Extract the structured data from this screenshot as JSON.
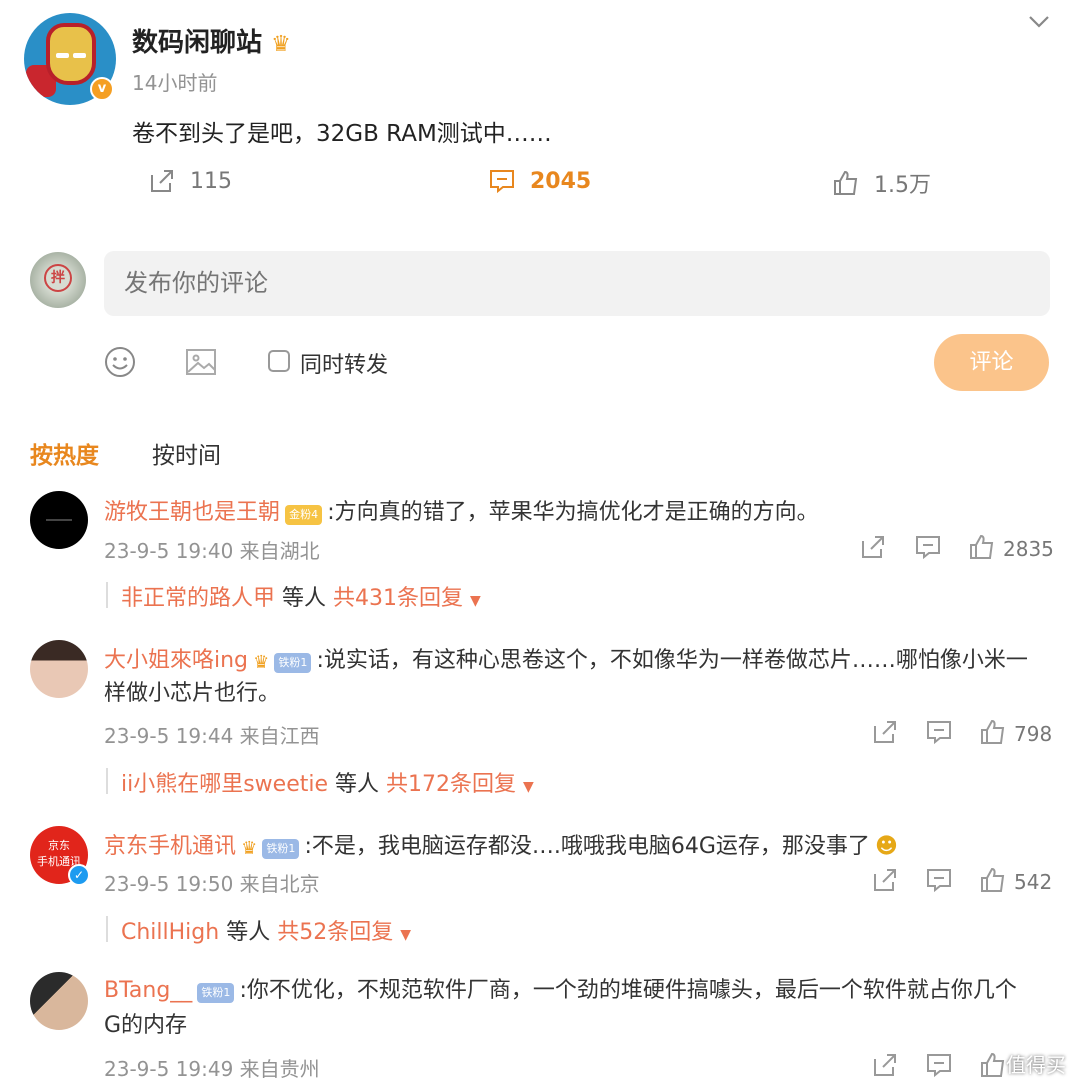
{
  "post": {
    "username": "数码闲聊站",
    "time_ago": "14小时前",
    "text": "卷不到头了是吧，32GB RAM测试中……",
    "reposts": "115",
    "comments": "2045",
    "likes": "1.5万",
    "accent": "#e8871e"
  },
  "composer": {
    "placeholder": "发布你的评论",
    "also_repost_label": "同时转发",
    "submit_label": "评论",
    "avatar_char": "拌"
  },
  "sort": {
    "hot": "按热度",
    "time": "按时间"
  },
  "comments": [
    {
      "name": "游牧王朝也是王朝",
      "badge": "金粉4",
      "text": ":方向真的错了，苹果华为搞优化才是正确的方向。",
      "meta": "23-9-5 19:40 来自湖北",
      "likes": "2835",
      "reply_name": "非正常的路人甲",
      "reply_mid": "等人",
      "reply_count": "共431条回复"
    },
    {
      "name": "大小姐來咯ing",
      "badge": "铁粉1",
      "text_line1": ":说实话，有这种心思卷这个，不如像华为一样卷做芯片……哪怕像小米一",
      "text_line2": "样做小芯片也行。",
      "meta": "23-9-5 19:44 来自江西",
      "likes": "798",
      "reply_name": "ii小熊在哪里sweetie",
      "reply_mid": "等人",
      "reply_count": "共172条回复"
    },
    {
      "name": "京东手机通讯",
      "badge": "铁粉1",
      "text": ":不是，我电脑运存都没….哦哦我电脑64G运存，那没事了",
      "avatar_text": "京东\n手机通讯",
      "meta": "23-9-5 19:50 来自北京",
      "likes": "542",
      "reply_name": "ChillHigh",
      "reply_mid": "等人",
      "reply_count": "共52条回复"
    },
    {
      "name": "BTang__",
      "badge": "铁粉1",
      "text_line1": ":你不优化，不规范软件厂商，一个劲的堆硬件搞噱头，最后一个软件就占你几个",
      "text_line2": "G的内存",
      "meta": "23-9-5 19:49 来自贵州"
    }
  ],
  "watermark": "值得买"
}
